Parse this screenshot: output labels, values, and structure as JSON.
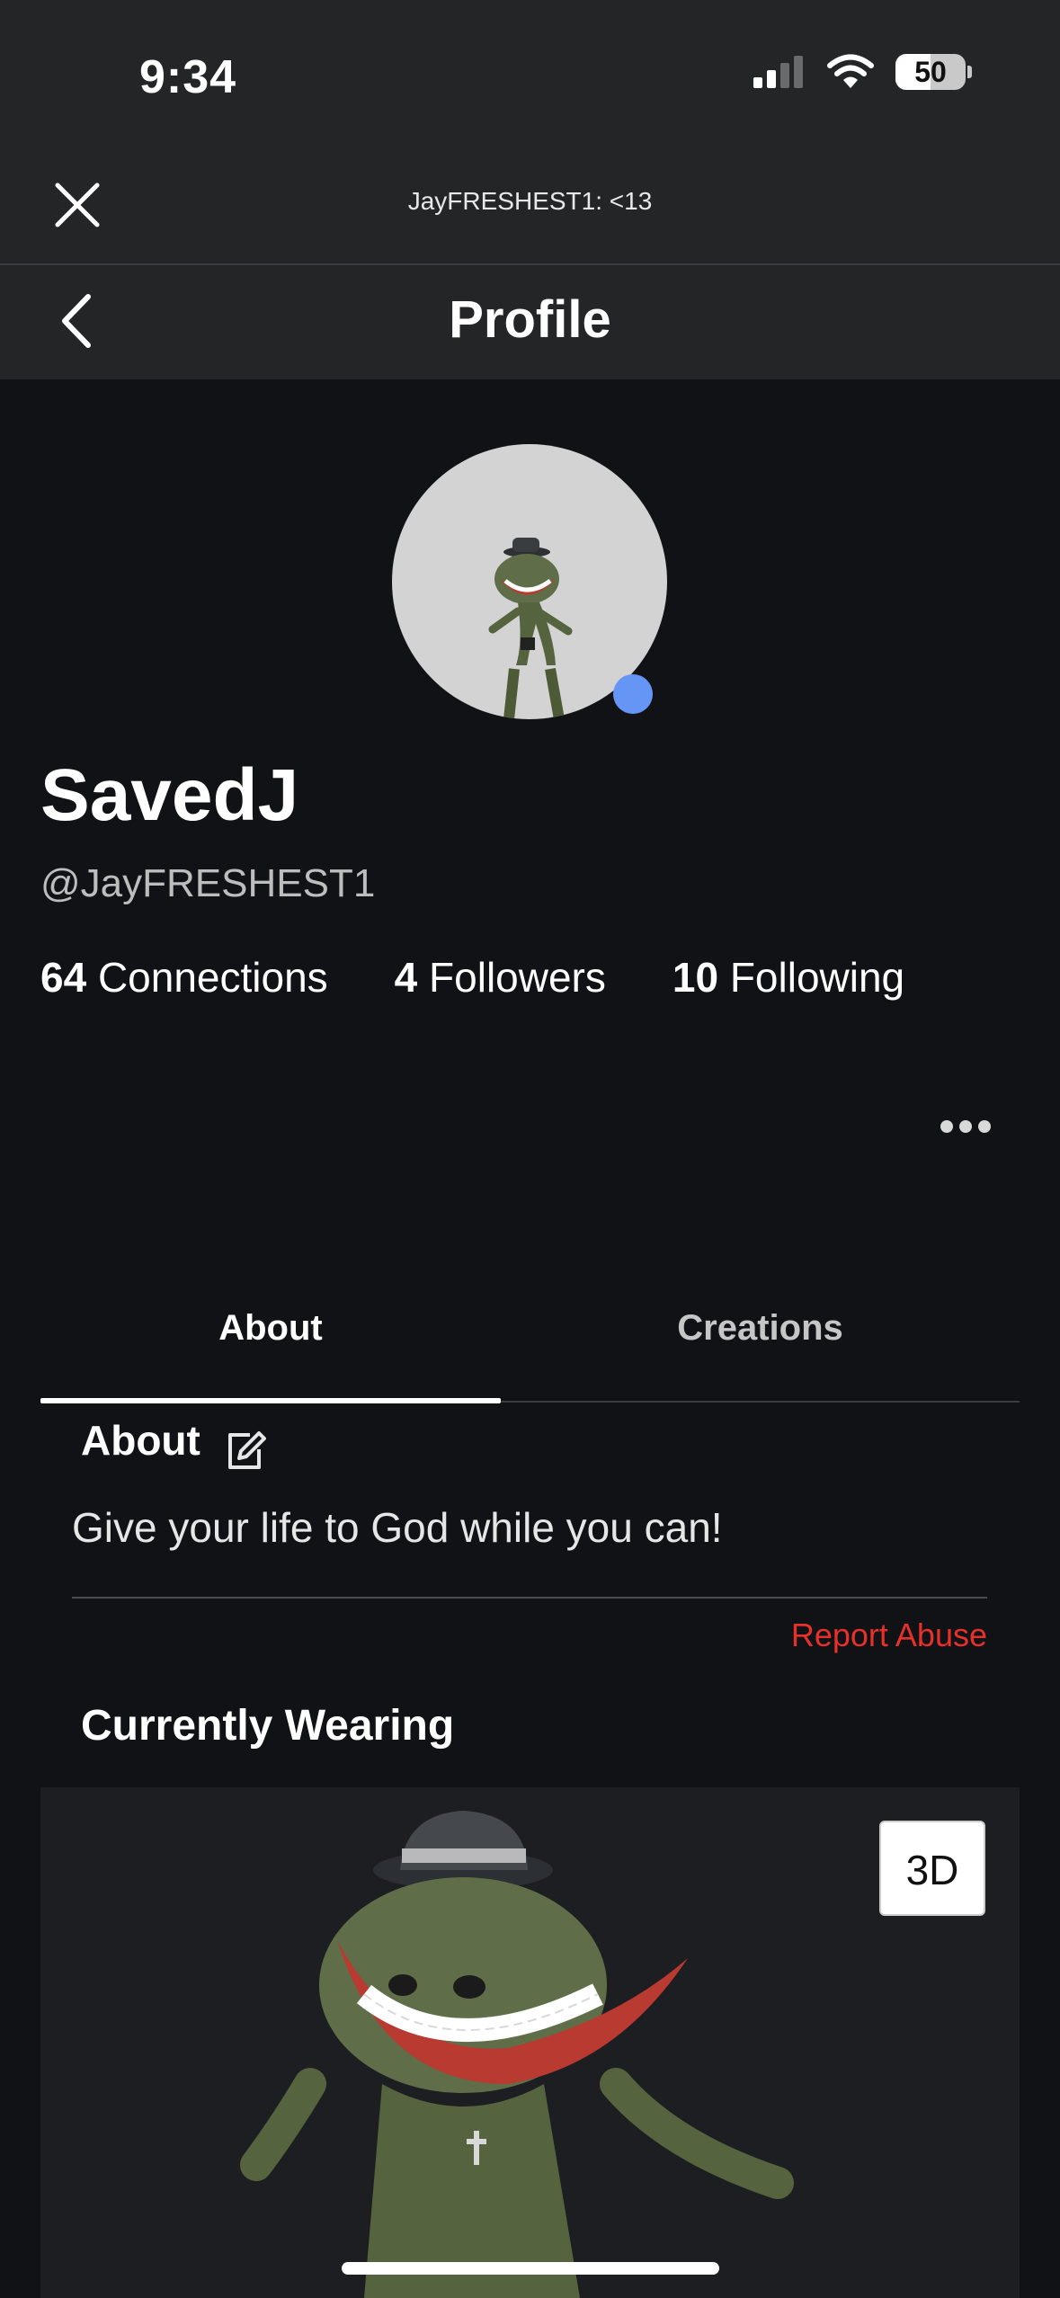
{
  "status_bar": {
    "time": "9:34",
    "battery": "50",
    "battery_level": 0.5
  },
  "notification": {
    "text": "JayFRESHEST1: <13"
  },
  "nav": {
    "title": "Profile"
  },
  "profile": {
    "display_name": "SavedJ",
    "username": "@JayFRESHEST1",
    "online_color": "#6596f5",
    "stats": [
      {
        "count": "64",
        "label": "Connections"
      },
      {
        "count": "4",
        "label": "Followers"
      },
      {
        "count": "10",
        "label": "Following"
      }
    ]
  },
  "tabs": [
    {
      "label": "About",
      "active": true
    },
    {
      "label": "Creations",
      "active": false
    }
  ],
  "about": {
    "heading": "About",
    "text": "Give your life to God while you can!",
    "report_label": "Report Abuse"
  },
  "wearing": {
    "heading": "Currently Wearing",
    "btn_3d": "3D"
  },
  "colors": {
    "accent_red": "#e5312a",
    "background": "#111216",
    "header": "#232527"
  }
}
